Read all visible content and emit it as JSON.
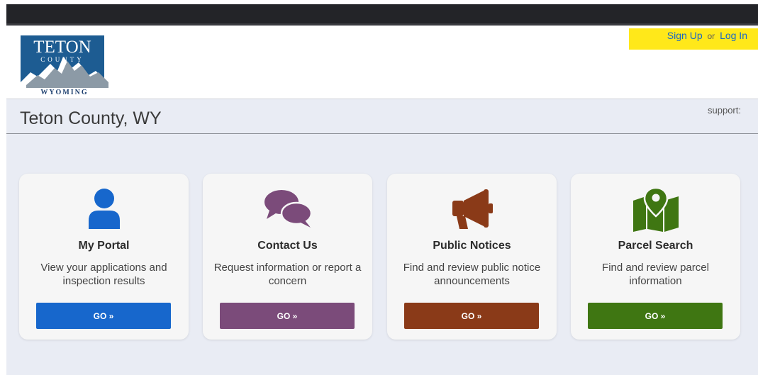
{
  "logo": {
    "line1": "TETON",
    "line2": "COUNTY",
    "line3": "WYOMING",
    "colors": {
      "blue": "#1d5c92",
      "mountain": "#8c9aa6",
      "text": "#1d3f6e"
    }
  },
  "auth": {
    "sign_up": "Sign Up",
    "or": "or",
    "log_in": "Log In",
    "highlight": "#ffe81a"
  },
  "header": {
    "title": "Teton County, WY",
    "support_label": "support:"
  },
  "cards": [
    {
      "title": "My Portal",
      "description": "View your applications and inspection results",
      "button": "GO »",
      "color": "#1767cc",
      "icon": "user-icon"
    },
    {
      "title": "Contact Us",
      "description": "Request information or report a concern",
      "button": "GO »",
      "color": "#7b4b7a",
      "icon": "chat-bubbles-icon"
    },
    {
      "title": "Public Notices",
      "description": "Find and review public notice announcements",
      "button": "GO »",
      "color": "#8a3a18",
      "icon": "megaphone-icon"
    },
    {
      "title": "Parcel Search",
      "description": "Find and review parcel information",
      "button": "GO »",
      "color": "#3f7612",
      "icon": "map-pin-icon"
    }
  ]
}
